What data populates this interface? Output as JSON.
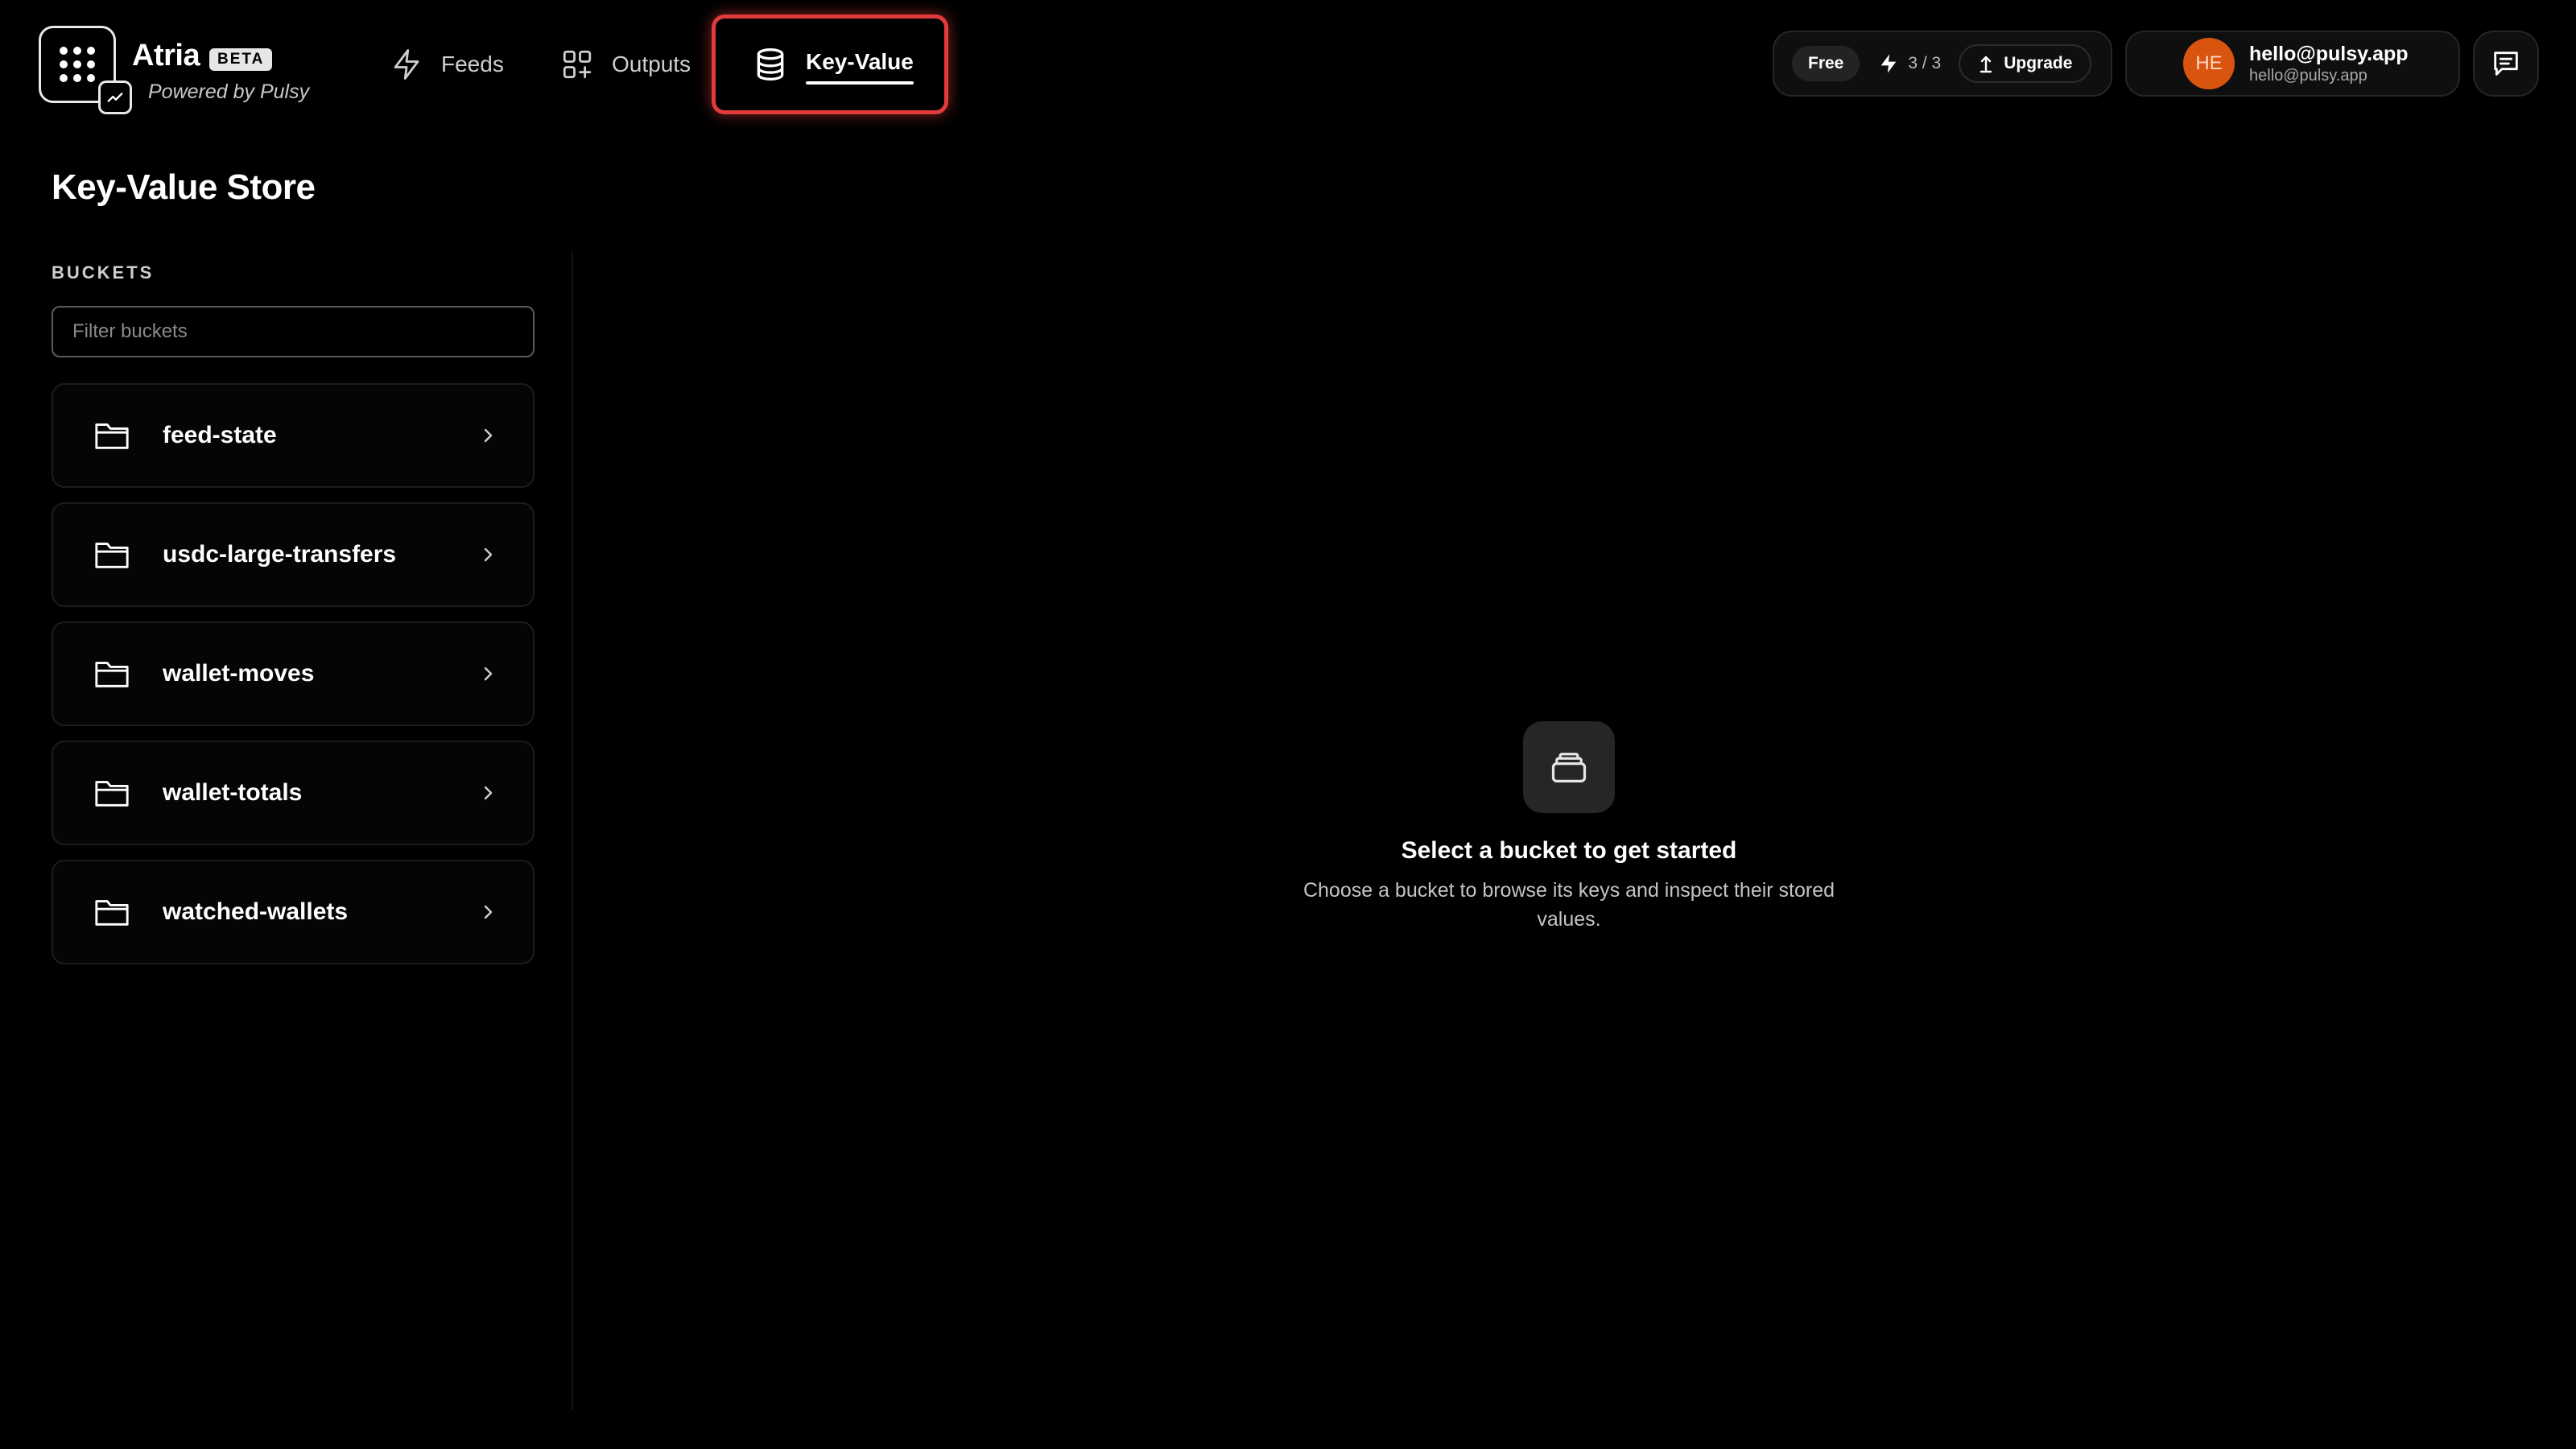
{
  "app": {
    "name": "Atria",
    "badge": "BETA",
    "tagline": "Powered by Pulsy"
  },
  "nav": {
    "items": [
      {
        "label": "Feeds",
        "icon": "lightning-icon",
        "active": false
      },
      {
        "label": "Outputs",
        "icon": "grid-plus-icon",
        "active": false
      },
      {
        "label": "Key-Value",
        "icon": "database-icon",
        "active": true
      }
    ]
  },
  "plan": {
    "tier": "Free",
    "credits": "3 / 3",
    "upgrade_label": "Upgrade"
  },
  "user": {
    "initials": "HE",
    "email": "hello@pulsy.app",
    "sub": "hello@pulsy.app"
  },
  "page": {
    "title": "Key-Value Store",
    "section_label": "BUCKETS",
    "filter_placeholder": "Filter buckets"
  },
  "buckets": [
    {
      "name": "feed-state"
    },
    {
      "name": "usdc-large-transfers"
    },
    {
      "name": "wallet-moves"
    },
    {
      "name": "wallet-totals"
    },
    {
      "name": "watched-wallets"
    }
  ],
  "empty_state": {
    "title": "Select a bucket to get started",
    "description": "Choose a bucket to browse its keys and inspect their stored values."
  },
  "colors": {
    "background": "#000000",
    "highlight": "#e23b3b",
    "avatar": "#d9540f"
  }
}
